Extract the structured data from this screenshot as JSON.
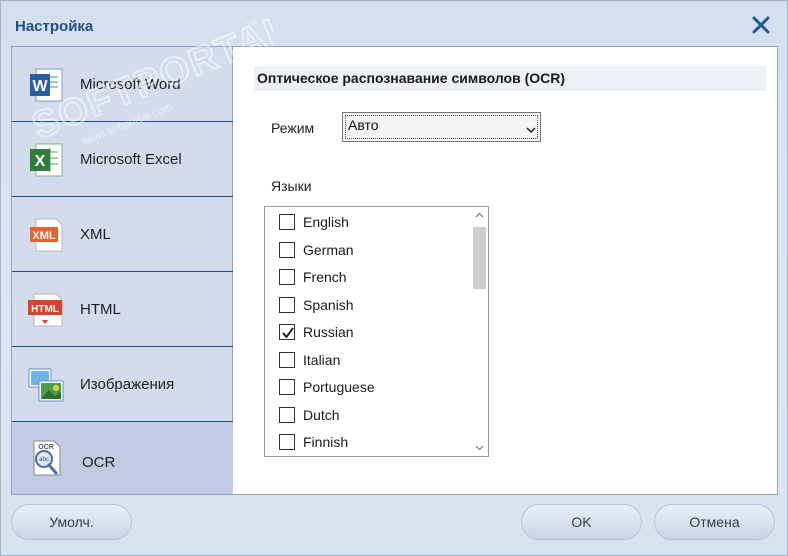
{
  "window": {
    "title": "Настройка",
    "close_icon": "close-icon"
  },
  "sidebar": {
    "items": [
      {
        "label": "Microsoft Word",
        "icon": "word-icon",
        "active": false
      },
      {
        "label": "Microsoft Excel",
        "icon": "excel-icon",
        "active": false
      },
      {
        "label": "XML",
        "icon": "xml-icon",
        "active": false
      },
      {
        "label": "HTML",
        "icon": "html-icon",
        "active": false
      },
      {
        "label": "Изображения",
        "icon": "images-icon",
        "active": false
      },
      {
        "label": "OCR",
        "icon": "ocr-icon",
        "active": true
      }
    ]
  },
  "main": {
    "section_title": "Оптическое распознавание символов (OCR)",
    "mode": {
      "label": "Режим",
      "value": "Авто"
    },
    "languages": {
      "label": "Языки",
      "items": [
        {
          "name": "English",
          "checked": false
        },
        {
          "name": "German",
          "checked": false
        },
        {
          "name": "French",
          "checked": false
        },
        {
          "name": "Spanish",
          "checked": false
        },
        {
          "name": "Russian",
          "checked": true
        },
        {
          "name": "Italian",
          "checked": false
        },
        {
          "name": "Portuguese",
          "checked": false
        },
        {
          "name": "Dutch",
          "checked": false
        },
        {
          "name": "Finnish",
          "checked": false
        }
      ]
    }
  },
  "buttons": {
    "defaults": "Умолч.",
    "ok": "OK",
    "cancel": "Отмена"
  },
  "watermark": {
    "text": "SOFTPORTAL",
    "url": "www.softportal.com",
    "tm": "TM"
  },
  "colors": {
    "title": "#1f4f87",
    "accent": "#1f4b80",
    "sidebar": "#d2dced"
  }
}
